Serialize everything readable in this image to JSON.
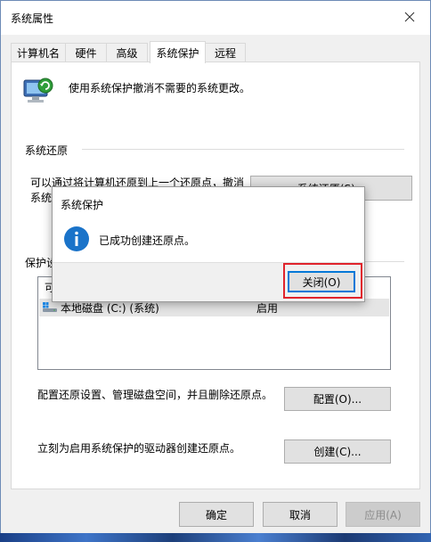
{
  "window": {
    "title": "系统属性",
    "close_icon": "close-icon"
  },
  "tabs": [
    {
      "label": "计算机名",
      "active": false
    },
    {
      "label": "硬件",
      "active": false
    },
    {
      "label": "高级",
      "active": false
    },
    {
      "label": "系统保护",
      "active": true
    },
    {
      "label": "远程",
      "active": false
    }
  ],
  "panel": {
    "intro_text": "使用系统保护撤消不需要的系统更改。",
    "restore_group_label": "系统还原",
    "restore_desc_line1": "可以通过将计算机还原到上一个还原点，撤消",
    "restore_desc_line2_partial": "系统",
    "restore_button": "系统还原(S)...",
    "protect_group_label_partial": "保护设",
    "list_header_partial": "可",
    "list_rows": [
      {
        "drive": "本地磁盘 (C:) (系统)",
        "protection": "启用",
        "icon": "drive-icon"
      }
    ],
    "config_desc": "配置还原设置、管理磁盘空间，并且删除还原点。",
    "config_button": "配置(O)...",
    "create_desc": "立刻为启用系统保护的驱动器创建还原点。",
    "create_button": "创建(C)..."
  },
  "footer": {
    "ok": "确定",
    "cancel": "取消",
    "apply": "应用(A)"
  },
  "dialog": {
    "title": "系统保护",
    "message": "已成功创建还原点。",
    "info_icon": "info-icon",
    "close_button": "关闭(O)"
  },
  "colors": {
    "accent": "#0078d7",
    "highlight": "#e0242c",
    "info": "#1a73c9"
  }
}
